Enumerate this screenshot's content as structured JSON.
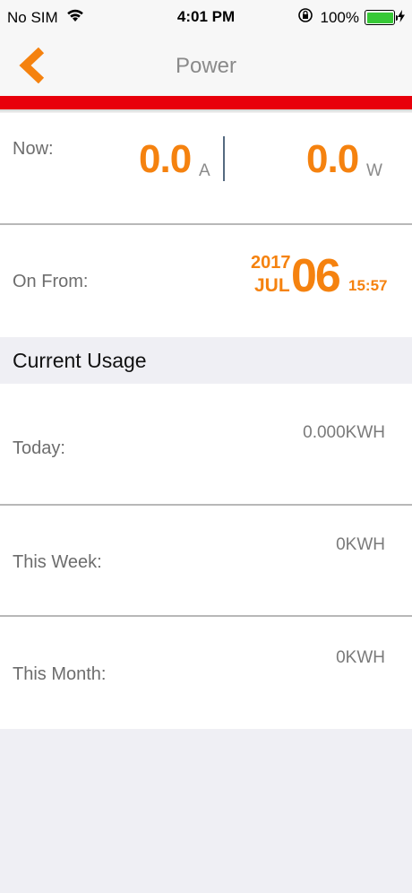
{
  "status_bar": {
    "carrier": "No SIM",
    "time": "4:01 PM",
    "battery": "100%"
  },
  "nav": {
    "title": "Power"
  },
  "now": {
    "label": "Now:",
    "current_value": "0.0",
    "current_unit": "A",
    "power_value": "0.0",
    "power_unit": "W"
  },
  "on_from": {
    "label": "On From:",
    "year": "2017",
    "month": "JUL",
    "day": "06",
    "time": "15:57"
  },
  "current_usage": {
    "header": "Current Usage",
    "rows": [
      {
        "label": "Today:",
        "value": "0.000KWH"
      },
      {
        "label": "This Week:",
        "value": "0KWH"
      },
      {
        "label": "This Month:",
        "value": "0KWH"
      }
    ]
  },
  "colors": {
    "accent": "#f5820f",
    "red_bar": "#e8000b",
    "battery_green": "#37c837"
  }
}
